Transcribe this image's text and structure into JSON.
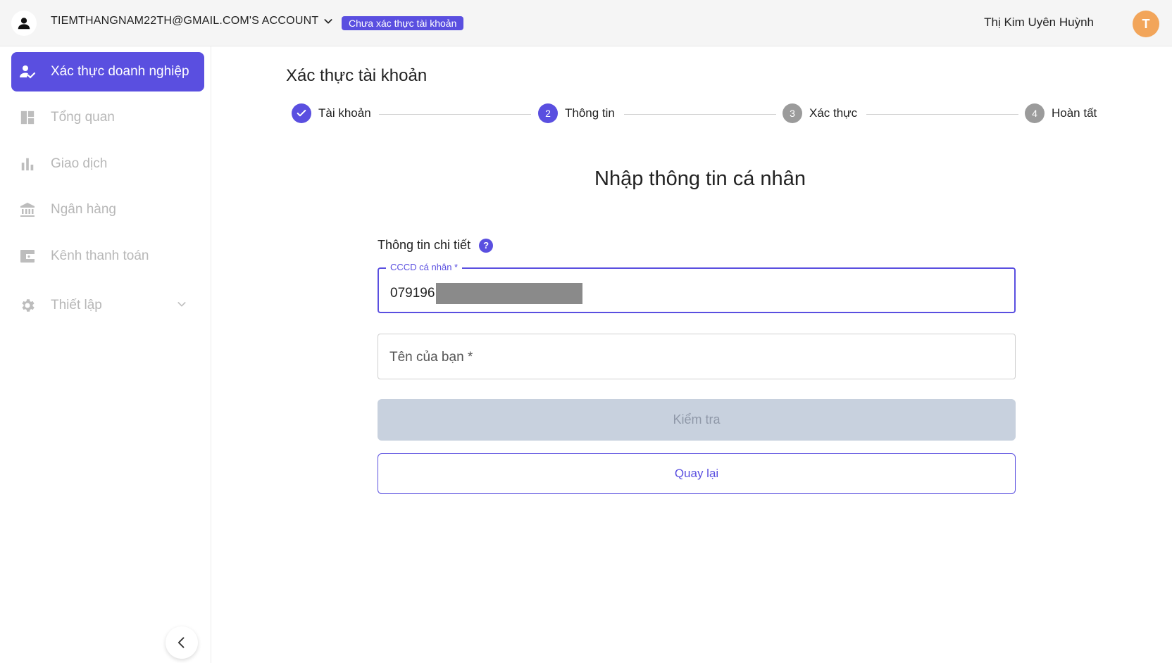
{
  "header": {
    "account_label": "TIEMTHANGNAM22TH@GMAIL.COM'S ACCOUNT",
    "badge": "Chưa xác thực tài khoản",
    "user_name": "Thị Kim Uyên Huỳnh",
    "user_initial": "T"
  },
  "sidebar": {
    "items": [
      {
        "label": "Xác thực doanh nghiệp",
        "icon": "user-check-icon",
        "active": true
      },
      {
        "label": "Tổng quan",
        "icon": "dashboard-icon"
      },
      {
        "label": "Giao dịch",
        "icon": "bar-chart-icon"
      },
      {
        "label": "Ngân hàng",
        "icon": "bank-icon"
      },
      {
        "label": "Kênh thanh toán",
        "icon": "wallet-icon"
      },
      {
        "label": "Thiết lập",
        "icon": "gear-icon"
      }
    ]
  },
  "main": {
    "title": "Xác thực tài khoản",
    "steps": [
      {
        "number": "1",
        "label": "Tài khoản",
        "state": "done"
      },
      {
        "number": "2",
        "label": "Thông tin",
        "state": "current"
      },
      {
        "number": "3",
        "label": "Xác thực",
        "state": "pending"
      },
      {
        "number": "4",
        "label": "Hoàn tất",
        "state": "pending"
      }
    ],
    "form_title": "Nhập thông tin cá nhân",
    "section_label": "Thông tin chi tiết",
    "cccd": {
      "label": "CCCD cá nhân *",
      "value": "079196"
    },
    "name_field": {
      "placeholder": "Tên của bạn *"
    },
    "check_button": "Kiểm tra",
    "back_button": "Quay lại"
  },
  "colors": {
    "accent": "#5a4fe0",
    "avatar": "#f2a55a"
  }
}
